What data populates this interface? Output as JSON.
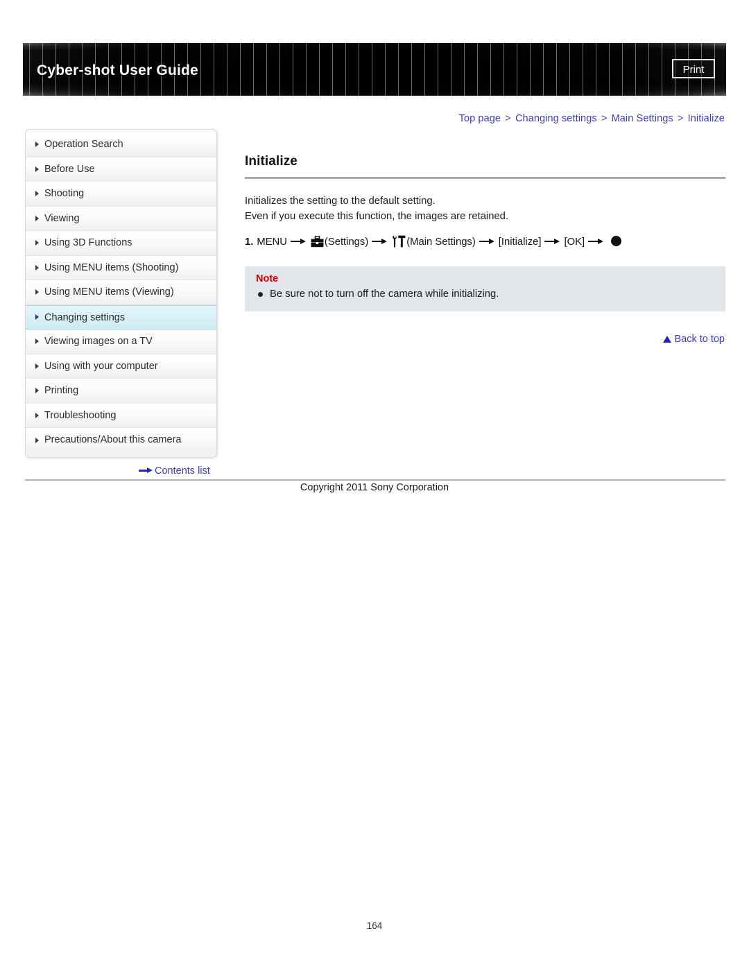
{
  "header": {
    "title": "Cyber-shot User Guide",
    "print_label": "Print"
  },
  "breadcrumb": {
    "separator": ">",
    "items": [
      {
        "label": "Top page"
      },
      {
        "label": "Changing settings"
      },
      {
        "label": "Main Settings"
      },
      {
        "label": "Initialize"
      }
    ]
  },
  "sidebar": {
    "items": [
      {
        "label": "Operation Search",
        "active": false
      },
      {
        "label": "Before Use",
        "active": false
      },
      {
        "label": "Shooting",
        "active": false
      },
      {
        "label": "Viewing",
        "active": false
      },
      {
        "label": "Using 3D Functions",
        "active": false
      },
      {
        "label": "Using MENU items (Shooting)",
        "active": false
      },
      {
        "label": "Using MENU items (Viewing)",
        "active": false
      },
      {
        "label": "Changing settings",
        "active": true
      },
      {
        "label": "Viewing images on a TV",
        "active": false
      },
      {
        "label": "Using with your computer",
        "active": false
      },
      {
        "label": "Printing",
        "active": false
      },
      {
        "label": "Troubleshooting",
        "active": false
      },
      {
        "label": "Precautions/About this camera",
        "active": false
      }
    ],
    "contents_list_label": "Contents list"
  },
  "main": {
    "title": "Initialize",
    "paragraph_line_1": "Initializes the setting to the default setting.",
    "paragraph_line_2": "Even if you execute this function, the images are retained.",
    "step": {
      "number": "1.",
      "menu_label": "MENU",
      "settings_icon": "toolbox-icon",
      "settings_label": "(Settings)",
      "main_settings_icon": "wrench-hammer-icon",
      "main_settings_label": "(Main Settings)",
      "initialize_label": "[Initialize]",
      "ok_label": "[OK]",
      "center_button_icon": "filled-circle-icon"
    },
    "note": {
      "title": "Note",
      "items": [
        "Be sure not to turn off the camera while initializing."
      ]
    },
    "back_to_top_label": "Back to top"
  },
  "footer": {
    "copyright": "Copyright 2011 Sony Corporation",
    "page_number": "164"
  },
  "colors": {
    "link": "#3a3ac8",
    "note_title": "#cc0000",
    "note_background": "#e2e5e9",
    "active_sidebar": "#d8f0f8",
    "header_background": "#101010"
  }
}
